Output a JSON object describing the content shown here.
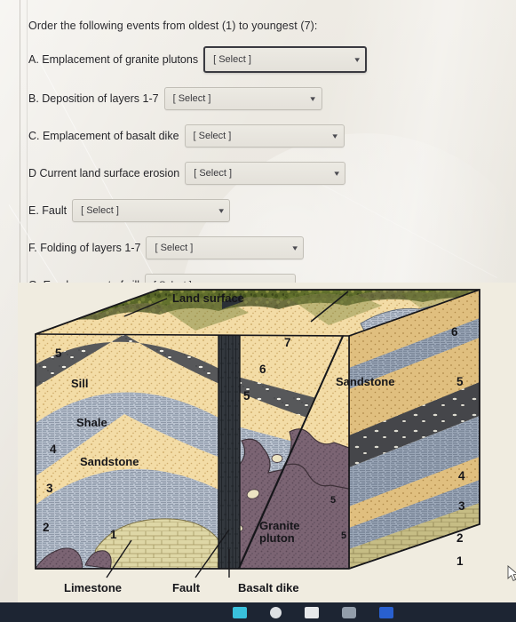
{
  "question": {
    "prompt": "Order the following events from oldest (1) to youngest (7):",
    "items": [
      {
        "label": "A. Emplacement of granite plutons",
        "value": "[ Select ]",
        "focused": true,
        "chevron": "chevron-down-icon"
      },
      {
        "label": "B. Deposition of layers 1-7",
        "value": "[ Select ]",
        "focused": false,
        "chevron": "chevron-down-icon"
      },
      {
        "label": "C. Emplacement of basalt dike",
        "value": "[ Select ]",
        "focused": false,
        "chevron": "chevron-down-icon"
      },
      {
        "label": "D  Current land surface erosion",
        "value": "[ Select ]",
        "focused": false,
        "chevron": "chevron-down-icon"
      },
      {
        "label": "E. Fault",
        "value": "[ Select ]",
        "focused": false,
        "chevron": "chevron-down-icon"
      },
      {
        "label": "F. Folding of layers 1-7",
        "value": "[ Select ]",
        "focused": false,
        "chevron": "chevron-down-icon"
      },
      {
        "label": "G. Emplacement of sill",
        "value": "[ Select ]",
        "focused": false,
        "chevron": "chevron-down-icon"
      }
    ]
  },
  "figure": {
    "type": "geologic-block-diagram",
    "callouts": {
      "land_surface": "Land surface",
      "sill": "Sill",
      "shale": "Shale",
      "sandstone_left": "Sandstone",
      "sandstone_right": "Sandstone",
      "limestone": "Limestone",
      "fault": "Fault",
      "basalt_dike": "Basalt dike",
      "granite_pluton_line1": "Granite",
      "granite_pluton_line2": "pluton"
    },
    "layer_numbers_left_face": [
      "5",
      "4",
      "3",
      "2",
      "1"
    ],
    "layer_numbers_top_center": [
      "7",
      "6",
      "5"
    ],
    "layer_numbers_right_face": [
      "6",
      "5",
      "4",
      "3",
      "2",
      "1"
    ],
    "xenolith_numbers": [
      "5",
      "5"
    ],
    "colors": {
      "sandstone": "#f3dca6",
      "shale": "#b9c2cf",
      "sill": "#57585a",
      "limestone": "#ded7a6",
      "granite": "#7b6473",
      "basalt": "#2f3338",
      "vegetation": "#5f6b2b",
      "figure_background": "#f0ece0",
      "page_background": "#eae7e0",
      "taskbar": "#1d2533"
    }
  },
  "cursor": {
    "name": "mouse-pointer"
  },
  "taskbar": {
    "icons": [
      "app-icon-teal",
      "app-icon-circle",
      "app-icon-white",
      "app-icon-gray",
      "app-icon-blue"
    ]
  }
}
